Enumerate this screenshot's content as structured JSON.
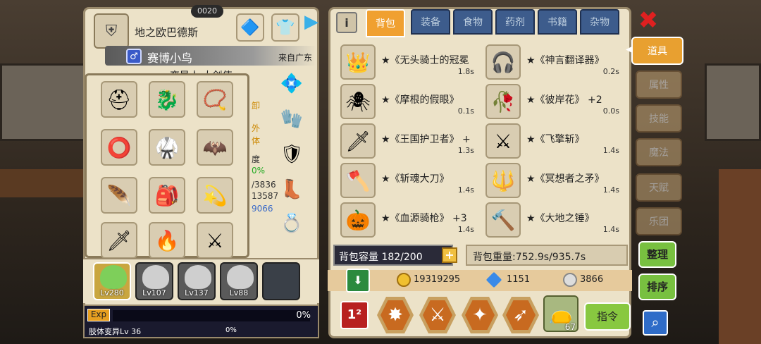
{
  "top_badge": "0020",
  "character": {
    "realm": "地之欧巴德斯",
    "gender": "♂",
    "name": "赛博小鸟",
    "origin": "来自广东",
    "subtitle": "变异人 大剑使",
    "partial_labels": [
      "卸",
      "外",
      "体",
      "度",
      "0%",
      "/3836",
      "13587",
      "9066"
    ]
  },
  "equipment_slots": [
    "blue-helmet",
    "red-dragon-helm",
    "gold-amulet",
    "red-necklace",
    "blue-armor",
    "purple-cape",
    "silver-feather",
    "red-jetpack",
    "gold-ring",
    "red-dagger",
    "fire-wand",
    "silver-sword"
  ],
  "party": {
    "members": [
      {
        "level": "Lv280",
        "selected": true
      },
      {
        "level": "Lv107",
        "selected": false
      },
      {
        "level": "Lv137",
        "selected": false
      },
      {
        "level": "Lv88",
        "selected": false
      }
    ]
  },
  "exp": {
    "badge": "Exp",
    "percent": "0%",
    "mutation_label": "肢体变异Lv 36",
    "mutation_percent": "0%"
  },
  "bag": {
    "info": "i",
    "tabs": [
      "背包",
      "装备",
      "食物",
      "药剂",
      "书籍",
      "杂物"
    ],
    "active_tab": "背包",
    "items": [
      {
        "name": "★《无头骑士的冠冕",
        "weight": "1.8s"
      },
      {
        "name": "★《神言翻译器》",
        "weight": "0.2s"
      },
      {
        "name": "★《摩根的假眼》",
        "weight": "0.1s"
      },
      {
        "name": "★《彼岸花》 +2",
        "weight": "0.0s"
      },
      {
        "name": "★《王国护卫者》 +",
        "weight": "1.3s"
      },
      {
        "name": "★《飞擎斩》",
        "weight": "1.4s"
      },
      {
        "name": "★《斩魂大刀》",
        "weight": "1.4s"
      },
      {
        "name": "★《冥想者之矛》",
        "weight": "1.4s"
      },
      {
        "name": "★《血源骑枪》 +3",
        "weight": "1.4s"
      },
      {
        "name": "★《大地之锤》",
        "weight": "1.4s"
      }
    ],
    "capacity": "背包容量 182/200",
    "weight_label": "背包重量:752.9s/935.7s",
    "gold": "19319295",
    "diamond": "1151",
    "silver": "3866",
    "skill_count": "67",
    "command": "指令"
  },
  "side": {
    "tabs": [
      "道具",
      "属性",
      "技能",
      "魔法",
      "天赋",
      "乐团"
    ],
    "active": "道具",
    "sort_label": "整理",
    "order_label": "排序"
  },
  "colors": {
    "accent": "#f0a030",
    "tab_inactive": "#3d5c8c",
    "panel": "#ece2c8",
    "confirm": "#78c040"
  }
}
